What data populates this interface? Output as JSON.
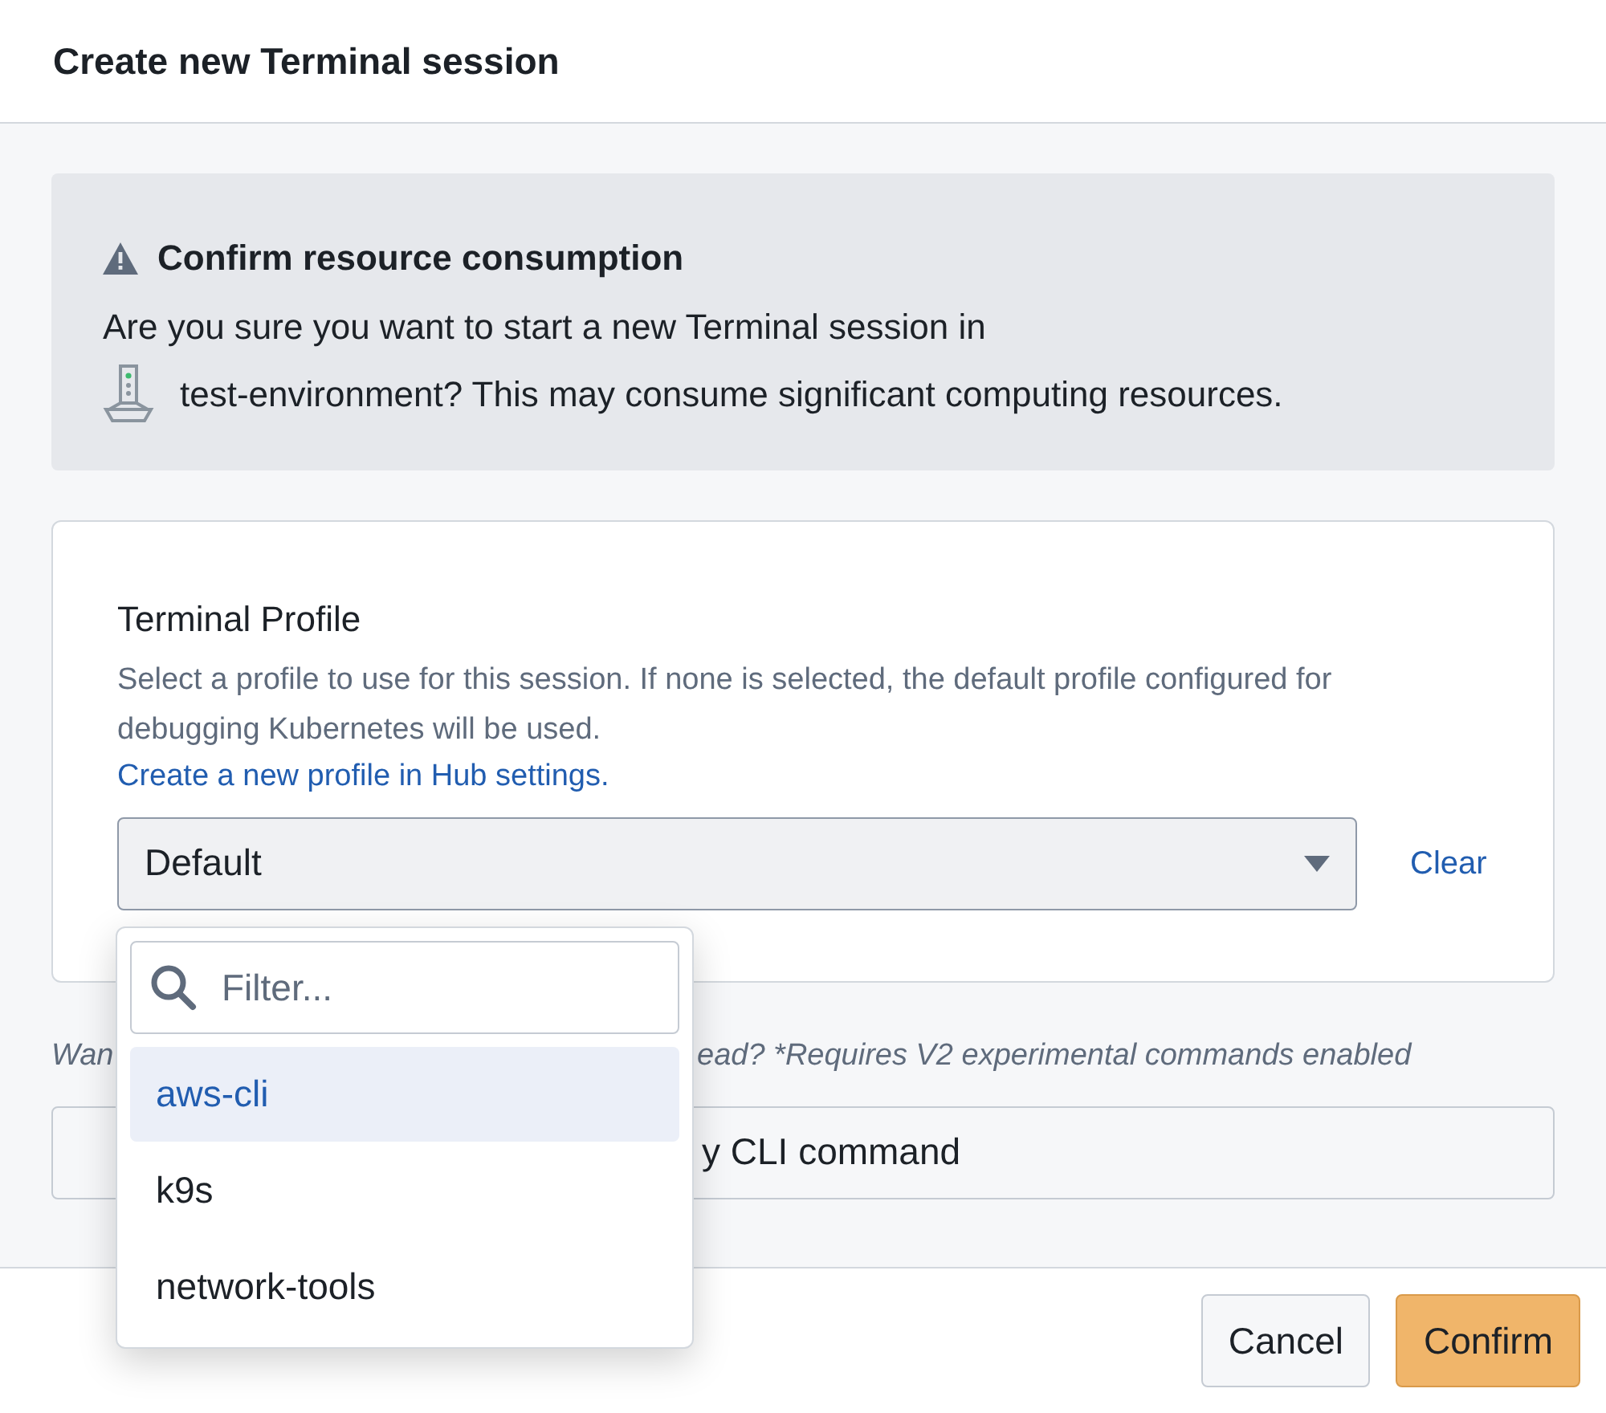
{
  "dialog": {
    "title": "Create new Terminal session"
  },
  "warning": {
    "title": "Confirm resource consumption",
    "message_start": "Are you sure you want to start a new Terminal session in",
    "message_end": "test-environment? This may consume significant computing resources."
  },
  "profile": {
    "label": "Terminal Profile",
    "description": "Select a profile to use for this session. If none is selected, the default profile configured for debugging Kubernetes will be used.",
    "link": "Create a new profile in Hub settings.",
    "value": "Default",
    "clear": "Clear",
    "expanded": true
  },
  "dropdown": {
    "filter_placeholder": "Filter...",
    "options": [
      {
        "label": "aws-cli",
        "selected": true
      },
      {
        "label": "k9s",
        "selected": false
      },
      {
        "label": "network-tools",
        "selected": false
      }
    ]
  },
  "hint": {
    "start": "Wan",
    "end": "ead? *Requires V2 experimental commands enabled"
  },
  "cli_button": {
    "label_end": "y CLI command"
  },
  "footer": {
    "buttons": [
      {
        "label": "Cancel",
        "kind": "secondary"
      },
      {
        "label": "Confirm",
        "kind": "primary"
      }
    ]
  }
}
